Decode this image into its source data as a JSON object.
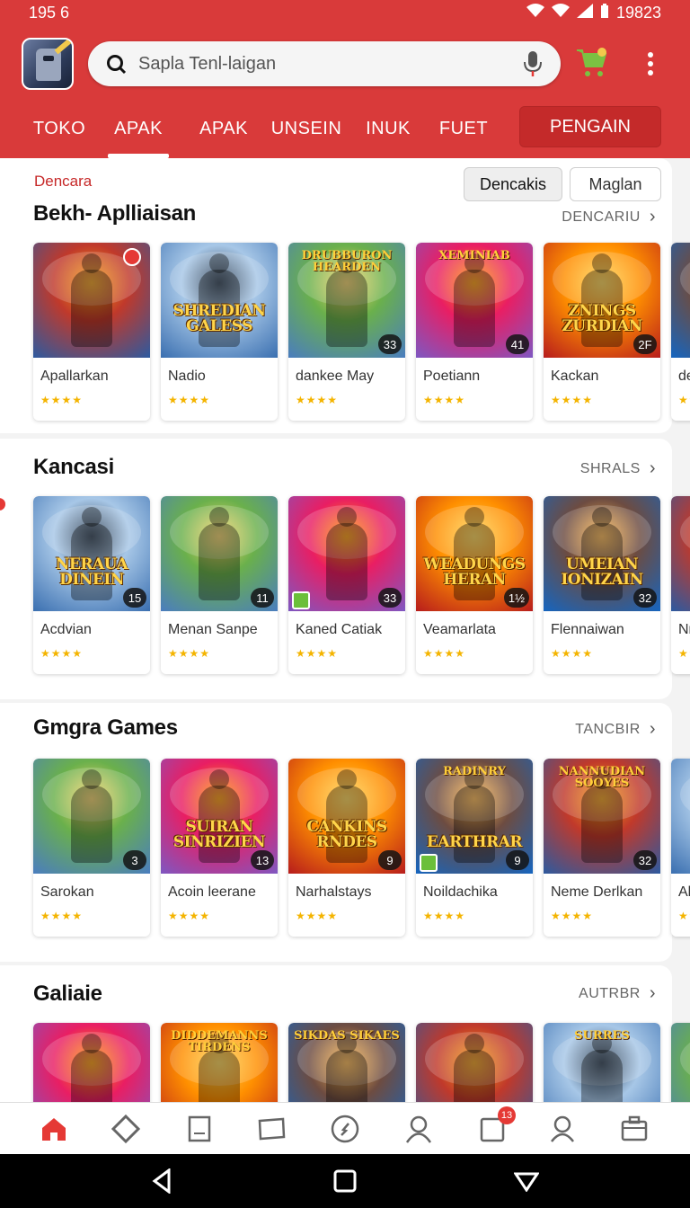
{
  "status_bar": {
    "time": "195 6",
    "battery_text": "19823"
  },
  "header": {
    "search_placeholder": "Sapla Tenl-laigan",
    "tabs": [
      {
        "label": "TOKO"
      },
      {
        "label": "APAK"
      },
      {
        "label": "APAK"
      },
      {
        "label": "UNSEIN"
      },
      {
        "label": "INUK"
      },
      {
        "label": "FUET"
      }
    ],
    "tab_button": "PENGAIN",
    "colors": {
      "brand": "#d93a3a",
      "brand_dark": "#c42a2a"
    }
  },
  "sections": [
    {
      "kicker": "Dencara",
      "filters": [
        "Dencakis",
        "Maglan"
      ],
      "title": "Bekh- Aplliaisan",
      "link": "DENCARIU",
      "cards": [
        {
          "name": "Apallarkan",
          "badge": "",
          "art": "",
          "rating": "★★★★"
        },
        {
          "name": "Nadio",
          "badge": "",
          "art": "SHREDIAN GALESS",
          "rating": "★★★★"
        },
        {
          "name": "dankee May",
          "badge": "33",
          "art": "",
          "top": "DRUBBURON HEARDEN",
          "rating": "★★★★"
        },
        {
          "name": "Poetiann",
          "badge": "41",
          "art": "",
          "top": "XEMINIAB",
          "rating": "★★★★"
        },
        {
          "name": "Kackan",
          "badge": "2F",
          "art": "ZNINGS ZURDIAN",
          "rating": "★★★★"
        },
        {
          "name": "de",
          "badge": "",
          "art": "",
          "rating": "★★"
        }
      ]
    },
    {
      "title": "Kancasi",
      "link": "SHRALS",
      "cards": [
        {
          "name": "Acdvian",
          "badge": "15",
          "art": "NERAUA DINEIN",
          "rating": "★★★★"
        },
        {
          "name": "Menan Sanpe",
          "badge": "11",
          "art": "",
          "rating": "★★★★"
        },
        {
          "name": "Kaned Catiak",
          "badge": "33",
          "art": "",
          "rating": "★★★★"
        },
        {
          "name": "Veamarlata",
          "badge": "1½",
          "art": "WEADUNGS HERAN",
          "rating": "★★★★"
        },
        {
          "name": "Flennaiwan",
          "badge": "32",
          "art": "UMEIAN IONIZAIN",
          "rating": "★★★★"
        },
        {
          "name": "Nr",
          "badge": "",
          "art": "",
          "rating": "★★"
        }
      ]
    },
    {
      "title": "Gmgra Games",
      "link": "TANCBIR",
      "cards": [
        {
          "name": "Sarokan",
          "badge": "3",
          "art": "",
          "rating": "★★★★"
        },
        {
          "name": "Acoin leerane",
          "badge": "13",
          "art": "SUIRAN SINRIZIEN",
          "rating": "★★★★"
        },
        {
          "name": "Narhalstays",
          "badge": "9",
          "art": "CANKINS RNDES",
          "rating": "★★★★"
        },
        {
          "name": "Noildachika",
          "badge": "9",
          "art": "EARTHRAR",
          "top": "RADINRY",
          "rating": "★★★★"
        },
        {
          "name": "Neme Derlkan",
          "badge": "32",
          "art": "",
          "top": "NANNUDIAN SOOYES",
          "rating": "★★★★"
        },
        {
          "name": "Al",
          "badge": "",
          "art": "",
          "rating": "★★"
        }
      ]
    },
    {
      "title": "Galiaie",
      "link": "AUTRBR",
      "cards": [
        {
          "name": "",
          "badge": "",
          "art": "",
          "rating": ""
        },
        {
          "name": "",
          "badge": "",
          "art": "",
          "top": "DIDDEMANNS TIRDENS",
          "rating": ""
        },
        {
          "name": "",
          "badge": "",
          "art": "",
          "top": "SIKDAS SIKAES",
          "rating": ""
        },
        {
          "name": "",
          "badge": "",
          "art": "",
          "rating": ""
        },
        {
          "name": "",
          "badge": "",
          "art": "",
          "top": "SURRES",
          "rating": ""
        },
        {
          "name": "",
          "badge": "",
          "art": "",
          "rating": ""
        }
      ]
    }
  ],
  "bottom_nav": {
    "items": [
      "home-icon",
      "diamond-icon",
      "bookmark-icon",
      "ticket-icon",
      "compass-icon",
      "person-icon",
      "inbox-icon",
      "account-icon",
      "briefcase-icon"
    ],
    "inbox_badge": "13"
  }
}
